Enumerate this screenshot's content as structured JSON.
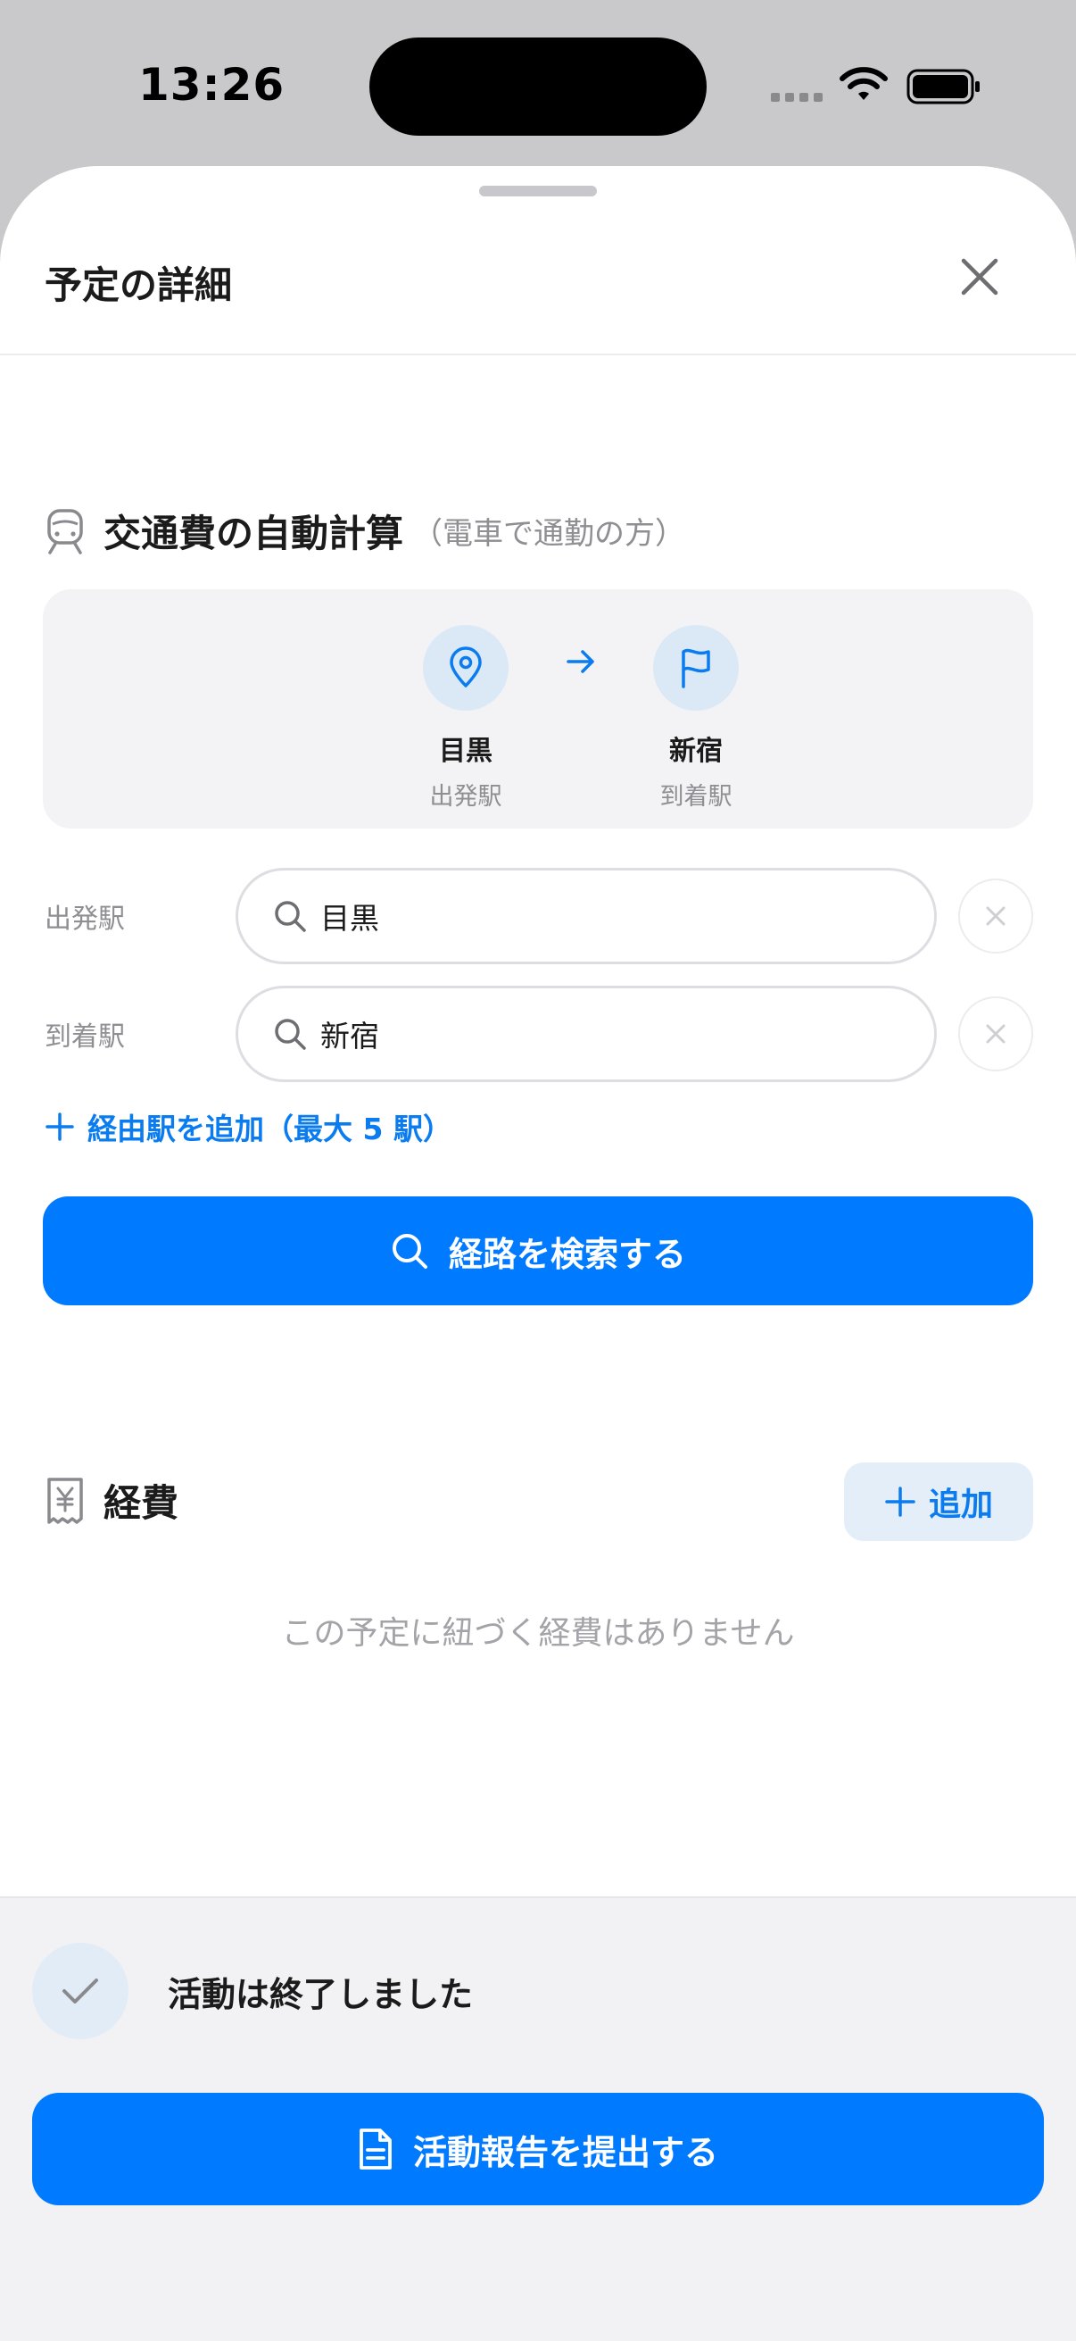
{
  "status_bar": {
    "time": "13:26"
  },
  "header": {
    "title": "予定の詳細"
  },
  "transport": {
    "title": "交通費の自動計算",
    "subtitle": "（電車で通勤の方）",
    "route": {
      "from_name": "目黒",
      "from_role": "出発駅",
      "to_name": "新宿",
      "to_role": "到着駅"
    },
    "departure": {
      "label": "出発駅",
      "value": "目黒"
    },
    "arrival": {
      "label": "到着駅",
      "value": "新宿"
    },
    "add_via_label": "経由駅を追加（最大 5 駅）",
    "search_button_label": "経路を検索する"
  },
  "expenses": {
    "title": "経費",
    "add_button_label": "追加",
    "empty_message": "この予定に紐づく経費はありません"
  },
  "activity": {
    "status_text": "活動は終了しました",
    "submit_button_label": "活動報告を提出する"
  },
  "colors": {
    "accent": "#007aff",
    "accent_light": "#dbe9f7",
    "muted_text": "#8e8e93"
  }
}
